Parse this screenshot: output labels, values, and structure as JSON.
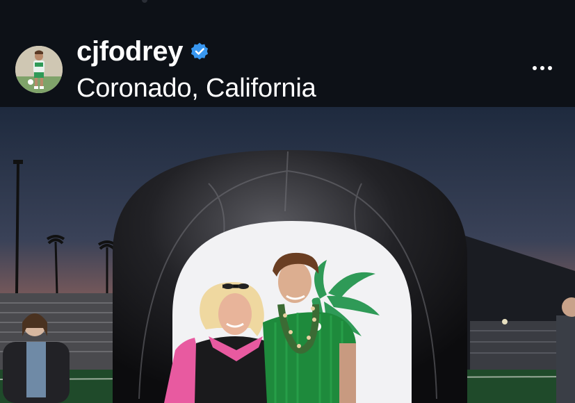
{
  "post": {
    "username": "cjfodrey",
    "location": "Coronado, California",
    "verified": true
  },
  "icons": {
    "verified": "verified-badge-icon",
    "more": "more-options-icon"
  },
  "photo": {
    "subject": "senior night photo on football field"
  },
  "colors": {
    "background": "#0d1117",
    "verified_blue": "#3897f0",
    "jersey_green": "#1e8a3c"
  }
}
